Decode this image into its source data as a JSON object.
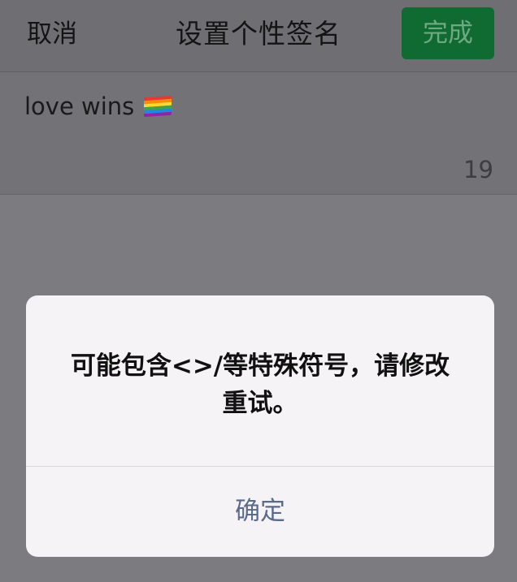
{
  "navbar": {
    "cancel_label": "取消",
    "title": "设置个性签名",
    "done_label": "完成"
  },
  "signature": {
    "text": "love wins",
    "emoji_icon": "rainbow-flag-icon",
    "char_count": "19"
  },
  "dialog": {
    "message": "可能包含<>/等特殊符号，请修改重试。",
    "confirm_label": "确定"
  },
  "colors": {
    "done_button_bg": "#0f6b32",
    "dialog_button_text": "#5a6a8a",
    "overlay": "#7c7b80"
  }
}
